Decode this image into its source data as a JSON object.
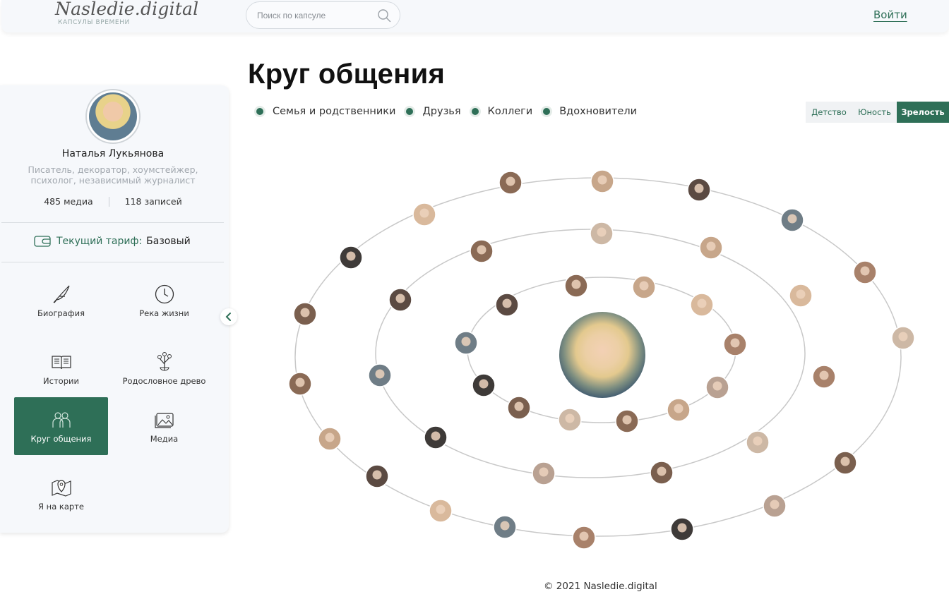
{
  "header": {
    "logo_text": "Nasledie.digital",
    "logo_subtitle": "КАПСУЛЫ ВРЕМЕНИ",
    "search_placeholder": "Поиск по капсуле",
    "login_label": "Войти"
  },
  "profile": {
    "name": "Наталья Лукьянова",
    "description": "Писатель, декоратор, хоумстейжер, психолог, независимый журналист",
    "media_count": "485 медиа",
    "records_count": "118 записей",
    "tariff_label": "Текущий тариф:",
    "tariff_value": "Базовый"
  },
  "menu": [
    {
      "label": "Биография",
      "icon": "feather-icon"
    },
    {
      "label": "Река жизни",
      "icon": "clock-icon"
    },
    {
      "label": "Истории",
      "icon": "book-icon"
    },
    {
      "label": "Родословное древо",
      "icon": "family-tree-icon"
    },
    {
      "label": "Круг общения",
      "icon": "people-icon",
      "active": true
    },
    {
      "label": "Медиа",
      "icon": "images-icon"
    },
    {
      "label": "Я на карте",
      "icon": "map-pin-icon"
    }
  ],
  "main": {
    "title": "Круг общения",
    "legend": [
      "Семья и родственники",
      "Друзья",
      "Коллеги",
      "Вдохновители"
    ],
    "period_tabs": [
      "Детство",
      "Юность",
      "Зрелость"
    ],
    "active_period": "Зрелость"
  },
  "footer": {
    "copyright": "© 2021 Nasledie.digital"
  },
  "colors": {
    "accent": "#2e6f57",
    "background": "#ffffff",
    "sidebar_bg": "#f6f8fb",
    "orbit_line": "#c8c8c8"
  }
}
